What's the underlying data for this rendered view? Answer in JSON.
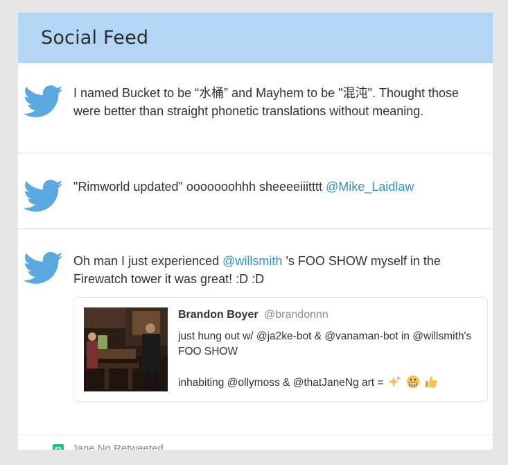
{
  "header": {
    "title": "Social Feed"
  },
  "tweets": [
    {
      "icon": "twitter-bird-icon",
      "text": "I named Bucket to be “水桶” and Mayhem to be \"混沌\".  Thought those were better than straight phonetic translations without meaning."
    },
    {
      "icon": "twitter-bird-icon",
      "text": "\"Rimworld updated\" ooooooohhh sheeeeiiitttt",
      "mention": "@Mike_Laidlaw"
    },
    {
      "icon": "twitter-bird-icon",
      "text_before": "Oh man I just experienced",
      "mention": "@willsmith",
      "text_after": "'s FOO SHOW myself in the Firewatch tower it was great!  :D :D",
      "quoted": {
        "author": "Brandon Boyer",
        "handle": "@brandonnn",
        "line1": "just hung out w/ @ja2ke-bot & @vanaman-bot in @willsmith's FOO SHOW",
        "line2": "inhabiting @ollymoss & @thatJaneNg art =",
        "emojis": [
          "sparkles-icon",
          "grimacing-face-icon",
          "thumbs-up-icon"
        ]
      }
    }
  ],
  "retweet": {
    "label": "Jane Ng Retweeted"
  },
  "colors": {
    "header_bg": "#b3d6f4",
    "bird": "#5aa9e0",
    "mention": "#2f8fcf"
  }
}
